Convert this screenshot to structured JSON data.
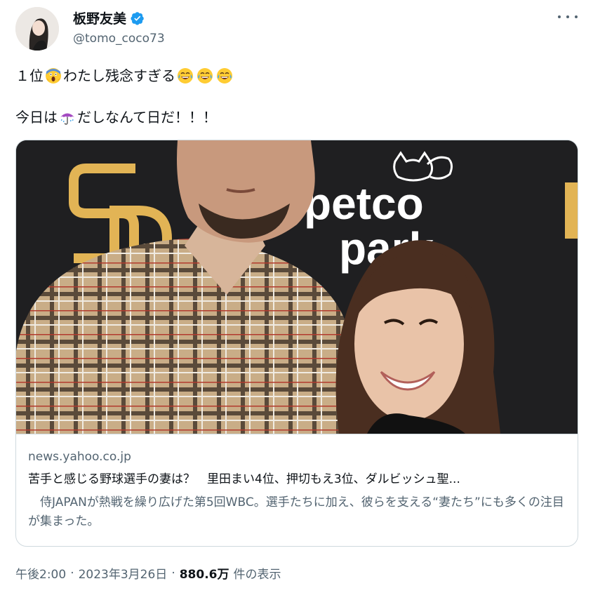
{
  "user": {
    "display_name": "板野友美",
    "handle": "@tomo_coco73",
    "verified": true
  },
  "tweet": {
    "line1_prefix": "１位",
    "line1_main": "わたし残念すぎる",
    "line2_prefix": "今日は",
    "line2_suffix": "だしなんて日だ！！！",
    "emojis": [
      "screaming-face-emoji",
      "tears-of-joy-emoji",
      "umbrella-rain-emoji"
    ]
  },
  "card": {
    "image_sign": {
      "line1": "petco",
      "line2": "park",
      "logo": "SD"
    },
    "domain": "news.yahoo.co.jp",
    "title": "苦手と感じる野球選手の妻は？　里田まい4位、押切もえ3位、ダルビッシュ聖...",
    "description": "　侍JAPANが熱戦を繰り広げた第5回WBC。選手たちに加え、彼らを支える“妻たち”にも多くの注目が集まった。"
  },
  "meta": {
    "time": "午後2:00",
    "sep1": "·",
    "date": "2023年3月26日",
    "sep2": "·",
    "views": "880.6万",
    "views_label": "件の表示"
  },
  "colors": {
    "verified_blue": "#1d9bf0",
    "text": "#0f1419",
    "muted": "#536471",
    "border": "#cfd9de",
    "padres_gold": "#e2b455"
  }
}
